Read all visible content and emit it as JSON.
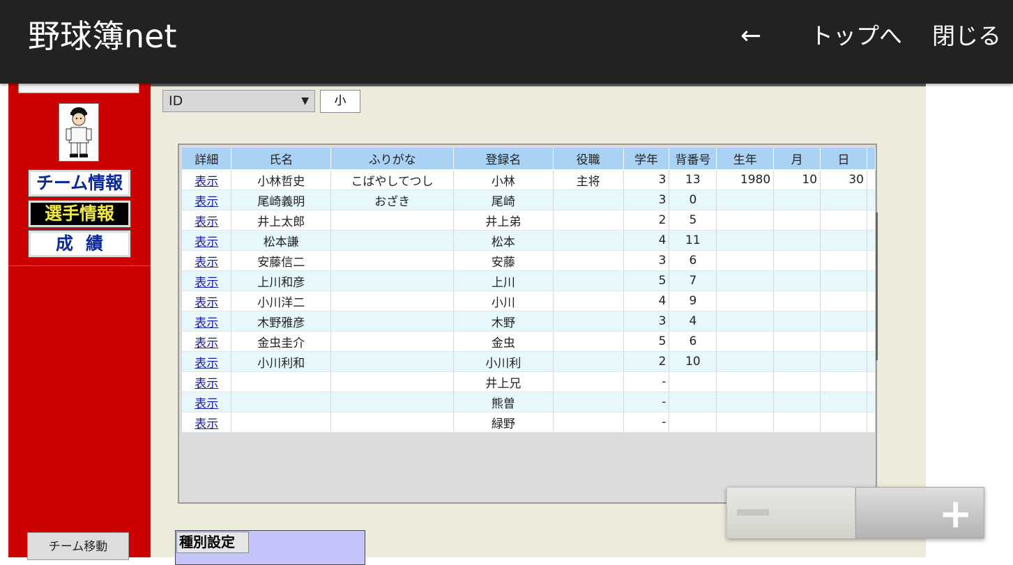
{
  "appbar": {
    "title": "野球簿net",
    "back": "←",
    "to_top": "トップへ",
    "close": "閉じる"
  },
  "sidebar": {
    "menu_team": "チーム情報",
    "menu_player": "選手情報",
    "menu_score": "成績",
    "team_move": "チーム移動"
  },
  "controls": {
    "sort_select": "ID",
    "size_button": "小"
  },
  "table": {
    "headers": [
      "詳細",
      "氏名",
      "ふりがな",
      "登録名",
      "役職",
      "学年",
      "背番号",
      "生年",
      "月",
      "日"
    ],
    "rows": [
      [
        "表示",
        "小林哲史",
        "こばやしてつし",
        "小林",
        "主将",
        "3",
        "13",
        "1980",
        "10",
        "30"
      ],
      [
        "表示",
        "尾崎義明",
        "おざき",
        "尾崎",
        "",
        "3",
        "0",
        "",
        "",
        ""
      ],
      [
        "表示",
        "井上太郎",
        "",
        "井上弟",
        "",
        "2",
        "5",
        "",
        "",
        ""
      ],
      [
        "表示",
        "松本謙",
        "",
        "松本",
        "",
        "4",
        "11",
        "",
        "",
        ""
      ],
      [
        "表示",
        "安藤信二",
        "",
        "安藤",
        "",
        "3",
        "6",
        "",
        "",
        ""
      ],
      [
        "表示",
        "上川和彦",
        "",
        "上川",
        "",
        "5",
        "7",
        "",
        "",
        ""
      ],
      [
        "表示",
        "小川洋二",
        "",
        "小川",
        "",
        "4",
        "9",
        "",
        "",
        ""
      ],
      [
        "表示",
        "木野雅彦",
        "",
        "木野",
        "",
        "3",
        "4",
        "",
        "",
        ""
      ],
      [
        "表示",
        "金虫圭介",
        "",
        "金虫",
        "",
        "5",
        "6",
        "",
        "",
        ""
      ],
      [
        "表示",
        "小川利和",
        "",
        "小川利",
        "",
        "2",
        "10",
        "",
        "",
        ""
      ],
      [
        "表示",
        "",
        "",
        "井上兄",
        "",
        "-",
        "",
        "",
        "",
        ""
      ],
      [
        "表示",
        "",
        "",
        "熊曽",
        "",
        "-",
        "",
        "",
        "",
        ""
      ],
      [
        "表示",
        "",
        "",
        "緑野",
        "",
        "-",
        "",
        "",
        "",
        ""
      ]
    ]
  },
  "zoom": {
    "plus": "+"
  },
  "type_settings": {
    "label": "種別設定"
  },
  "colors": {
    "appbar": "#222222",
    "sidebar_red": "#cc0000",
    "main_bg": "#ecebdc",
    "header_blue": "#a9d2f5",
    "row_alt": "#e6f8fb",
    "link": "#1a1aa8"
  }
}
